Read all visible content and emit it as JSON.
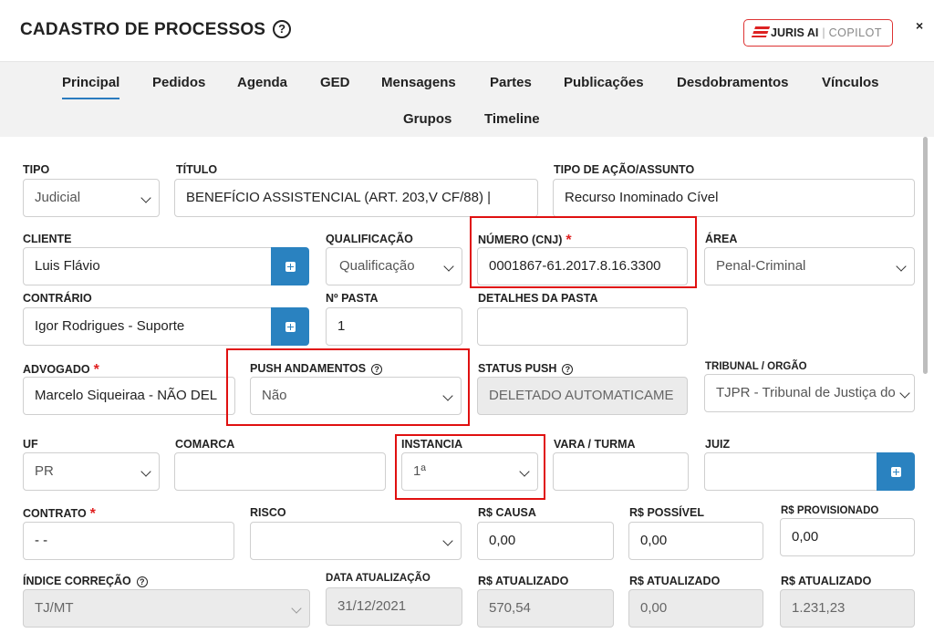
{
  "header": {
    "title": "CADASTRO DE PROCESSOS",
    "help": "?",
    "copilot_brand": "JURIS AI",
    "copilot_label": "COPILOT",
    "close": "×"
  },
  "tabs": [
    "Principal",
    "Pedidos",
    "Agenda",
    "GED",
    "Mensagens",
    "Partes",
    "Publicações",
    "Desdobramentos",
    "Vínculos",
    "Grupos",
    "Timeline"
  ],
  "active_tab": "Principal",
  "form": {
    "tipo": {
      "label": "TIPO",
      "value": "Judicial"
    },
    "titulo": {
      "label": "TÍTULO",
      "value": "BENEFÍCIO ASSISTENCIAL (ART. 203,V CF/88)  |"
    },
    "tipo_acao": {
      "label": "TIPO DE AÇÃO/ASSUNTO",
      "value": "Recurso Inominado Cível"
    },
    "cliente": {
      "label": "CLIENTE",
      "value": "Luis Flávio"
    },
    "qualificacao": {
      "label": "QUALIFICAÇÃO",
      "value": "Qualificação"
    },
    "numero": {
      "label": "NÚMERO (CNJ)",
      "required": "*",
      "value": "0001867-61.2017.8.16.3300"
    },
    "area": {
      "label": "ÁREA",
      "value": "Penal-Criminal"
    },
    "contrario": {
      "label": "CONTRÁRIO",
      "value": "Igor Rodrigues - Suporte"
    },
    "pasta": {
      "label": "Nº PASTA",
      "value": "1"
    },
    "detalhes_pasta": {
      "label": "DETALHES DA PASTA",
      "value": ""
    },
    "advogado": {
      "label": "ADVOGADO",
      "required": "*",
      "value": "Marcelo Siqueiraa - NÃO DEL"
    },
    "push": {
      "label": "PUSH ANDAMENTOS",
      "help": "?",
      "value": "Não"
    },
    "status_push": {
      "label": "STATUS PUSH",
      "help": "?",
      "value": "DELETADO AUTOMATICAME"
    },
    "tribunal": {
      "label": "TRIBUNAL / ORGÃO",
      "value": "TJPR - Tribunal de Justiça do"
    },
    "uf": {
      "label": "UF",
      "value": "PR"
    },
    "comarca": {
      "label": "COMARCA",
      "value": ""
    },
    "instancia": {
      "label": "INSTANCIA",
      "value": "1ª"
    },
    "vara": {
      "label": "VARA / TURMA",
      "value": ""
    },
    "juiz": {
      "label": "JUIZ",
      "value": ""
    },
    "contrato": {
      "label": "CONTRATO",
      "required": "*",
      "value": "- -"
    },
    "risco": {
      "label": "RISCO",
      "value": ""
    },
    "causa": {
      "label": "R$ CAUSA",
      "value": "0,00"
    },
    "possivel": {
      "label": "R$ POSSÍVEL",
      "value": "0,00"
    },
    "provisionado": {
      "label": "R$ PROVISIONADO",
      "value": "0,00"
    },
    "indice": {
      "label": "ÍNDICE CORREÇÃO",
      "help": "?",
      "value": "TJ/MT"
    },
    "data_atualizacao": {
      "label": "DATA ATUALIZAÇÃO",
      "value": "31/12/2021"
    },
    "atualizado1": {
      "label": "R$ ATUALIZADO",
      "value": "570,54"
    },
    "atualizado2": {
      "label": "R$ ATUALIZADO",
      "value": "0,00"
    },
    "atualizado3": {
      "label": "R$ ATUALIZADO",
      "value": "1.231,23"
    }
  },
  "colors": {
    "accent": "#2a82c0",
    "highlight": "#e01010",
    "required": "#e02020"
  }
}
